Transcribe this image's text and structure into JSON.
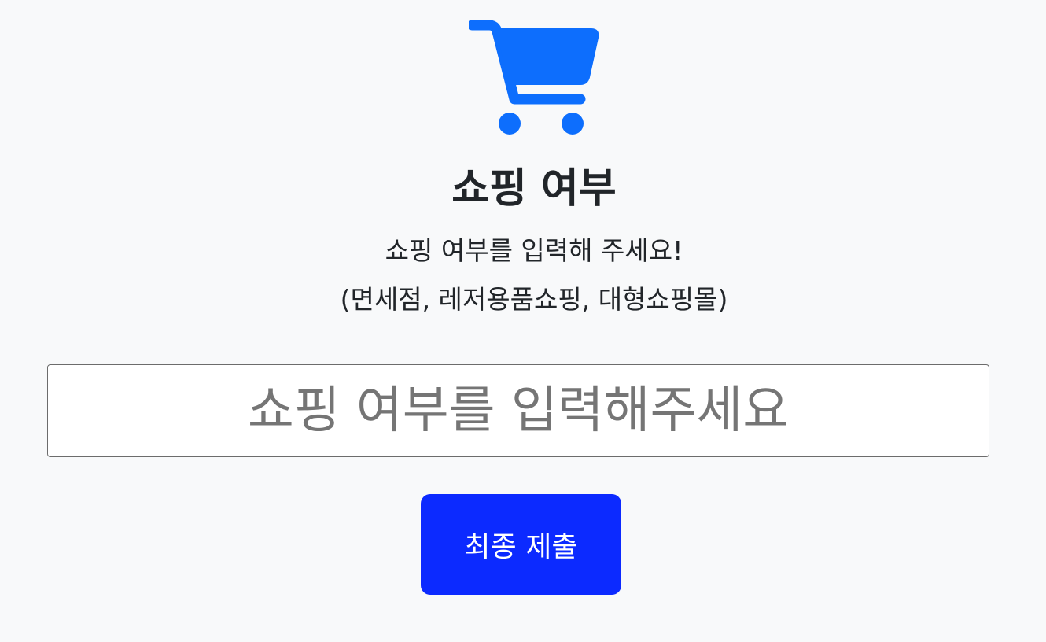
{
  "icon": {
    "name": "shopping-cart-icon",
    "color": "#0d6efd"
  },
  "header": {
    "title": "쇼핑 여부",
    "subtitle_line1": "쇼핑 여부를 입력해 주세요!",
    "subtitle_line2": "(면세점, 레저용품쇼핑, 대형쇼핑몰)"
  },
  "form": {
    "input_value": "",
    "input_placeholder": "쇼핑 여부를 입력해주세요",
    "submit_label": "최종 제출"
  },
  "colors": {
    "background": "#f8f9fa",
    "button": "#0c2aff",
    "icon": "#0d6efd"
  }
}
